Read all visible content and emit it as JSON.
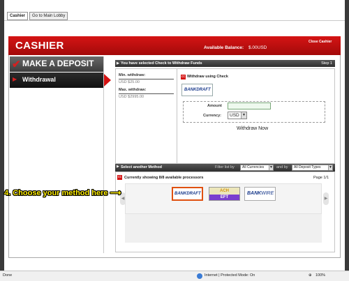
{
  "tabs": [
    {
      "label": "Cashier"
    },
    {
      "label": "Go to Main Lobby"
    }
  ],
  "header": {
    "title": "CASHIER",
    "balance_label": "Available Balance:",
    "balance_value": "$.00USD",
    "close_label": "Close Cashier"
  },
  "nav": {
    "deposit_label": "MAKE A DEPOSIT",
    "withdrawal_label": "Withdrawal"
  },
  "withdraw_section": {
    "header": "You have selected Check to Withdraw Funds",
    "step": "Step 1",
    "min_label": "Min. withdraw:",
    "min_value": "USD $25.00",
    "max_label": "Max. withdraw:",
    "max_value": "USD $2995.00",
    "method_title": "Withdraw using Check",
    "logo_text": "BANKDRAFT",
    "amount_label": "Amount",
    "amount_value": "",
    "currency_label": "Currency:",
    "currency_value": "USD",
    "submit_label": "Withdraw Now"
  },
  "method_section": {
    "header": "Select another Method",
    "filter_label": "Filter list by",
    "currency_filter": "All Currencies",
    "and_by": "and by",
    "type_filter": "All Deposit Types",
    "showing_text": "Currently showing 8/8 available processors",
    "page": "Page 1/1",
    "callout": "4. Choose your method here",
    "callout_arrow": "⟶",
    "processors": [
      {
        "name": "BANKDRAFT"
      },
      {
        "name_top": "ACH",
        "name_bottom": "EFT"
      },
      {
        "name_a": "BANK",
        "name_b": "WIRE"
      }
    ]
  },
  "statusbar": {
    "left": "Done",
    "zone": "Internet | Protected Mode: On",
    "zoom": "100%"
  },
  "colors": {
    "header_red": "#c81010",
    "callout_yellow": "#ffed00"
  }
}
